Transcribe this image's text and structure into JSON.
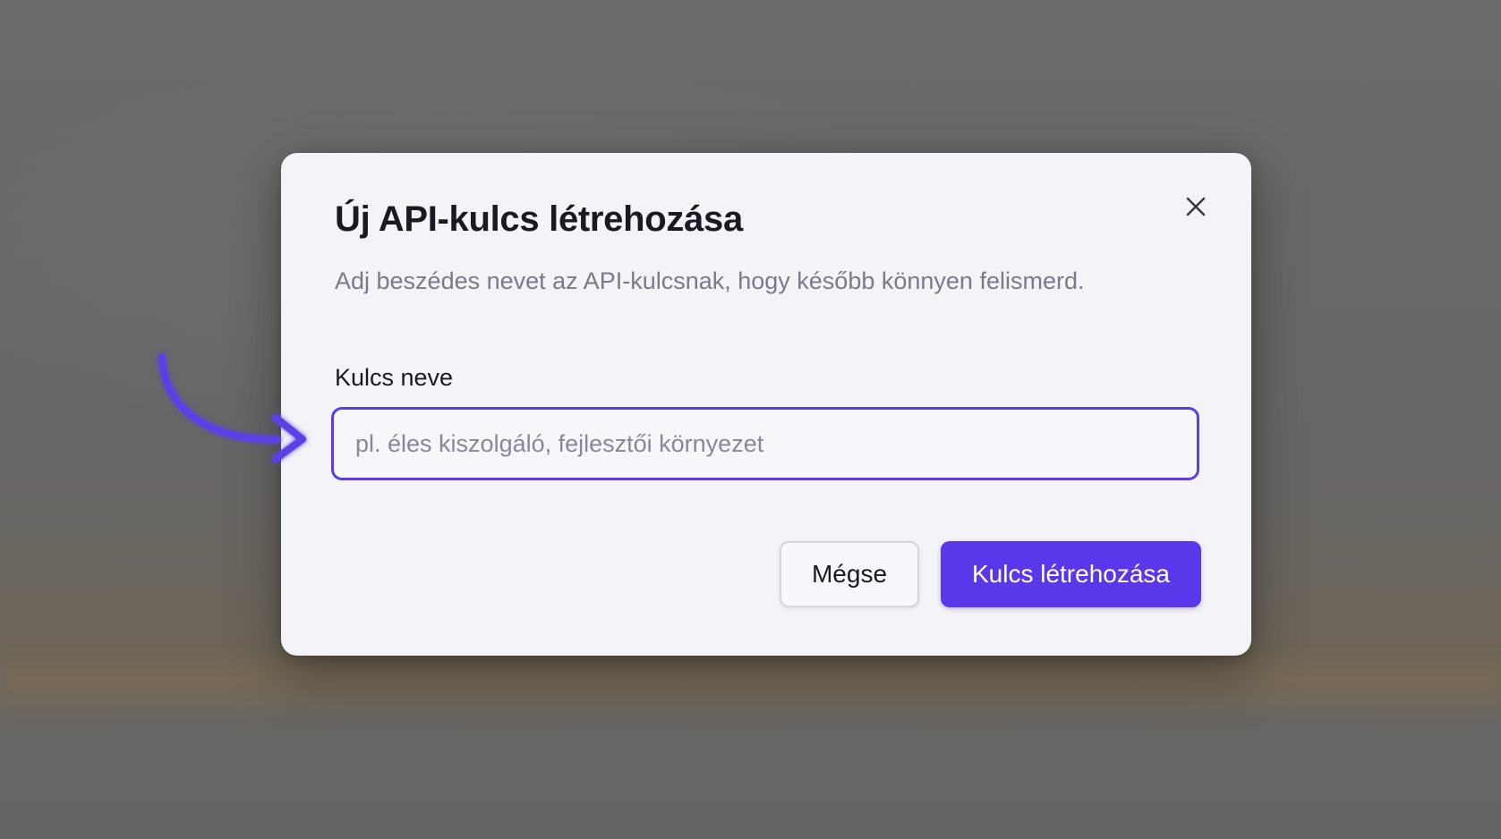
{
  "dialog": {
    "title": "Új API-kulcs létrehozása",
    "description": "Adj beszédes nevet az API-kulcsnak, hogy később könnyen felismerd.",
    "close_icon": "close-icon",
    "field": {
      "label": "Kulcs neve",
      "value": "",
      "placeholder": "pl. éles kiszolgáló, fejlesztői környezet"
    },
    "actions": {
      "cancel_label": "Mégse",
      "create_label": "Kulcs létrehozása"
    }
  },
  "annotation": {
    "icon": "curved-arrow-icon",
    "color": "#5b3fe6"
  },
  "colors": {
    "accent": "#5a37ea",
    "backdrop": "#666666",
    "dialog_background": "#f4f3f8"
  }
}
